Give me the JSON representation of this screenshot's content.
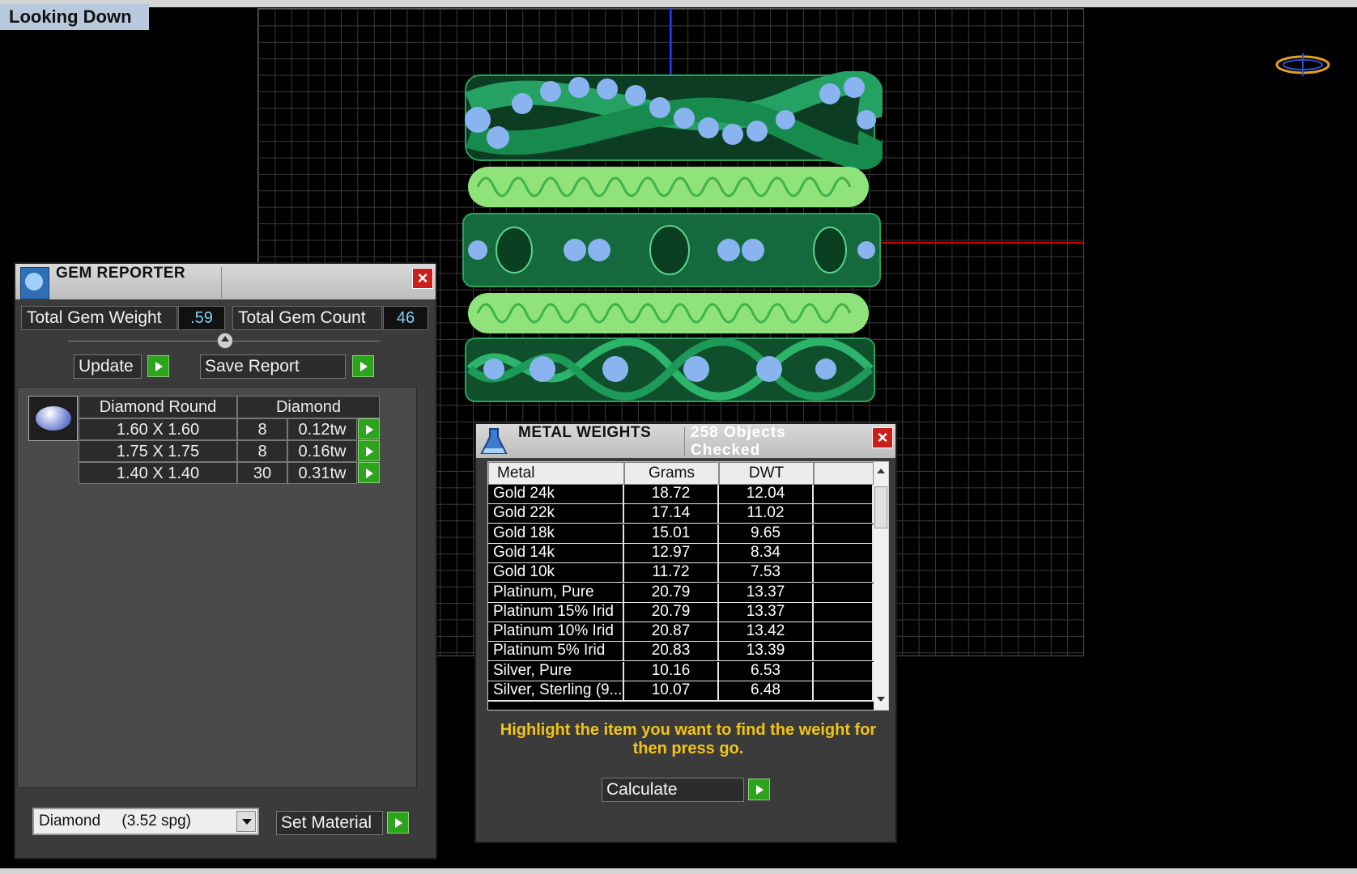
{
  "view": {
    "label": "Looking Down"
  },
  "gem_reporter": {
    "title": "GEM REPORTER",
    "total_weight_label": "Total Gem Weight",
    "total_weight_value": ".59",
    "total_count_label": "Total Gem Count",
    "total_count_value": "46",
    "update_label": "Update",
    "save_report_label": "Save Report",
    "gem_header": {
      "shape": "Diamond Round",
      "material": "Diamond"
    },
    "gems": [
      {
        "size": "1.60 X 1.60",
        "count": "8",
        "weight": "0.12tw"
      },
      {
        "size": "1.75 X 1.75",
        "count": "8",
        "weight": "0.16tw"
      },
      {
        "size": "1.40 X 1.40",
        "count": "30",
        "weight": "0.31tw"
      }
    ],
    "material_select": "Diamond     (3.52 spg)",
    "set_material_label": "Set Material"
  },
  "metal_weights": {
    "title": "METAL WEIGHTS",
    "objects_checked": "258 Objects Checked",
    "columns": [
      "Metal",
      "Grams",
      "DWT"
    ],
    "rows": [
      {
        "metal": "Gold 24k",
        "grams": "18.72",
        "dwt": "12.04"
      },
      {
        "metal": "Gold 22k",
        "grams": "17.14",
        "dwt": "11.02"
      },
      {
        "metal": "Gold 18k",
        "grams": "15.01",
        "dwt": "9.65"
      },
      {
        "metal": "Gold 14k",
        "grams": "12.97",
        "dwt": "8.34"
      },
      {
        "metal": "Gold 10k",
        "grams": "11.72",
        "dwt": "7.53"
      },
      {
        "metal": "Platinum, Pure",
        "grams": "20.79",
        "dwt": "13.37"
      },
      {
        "metal": "Platinum 15% Irid",
        "grams": "20.79",
        "dwt": "13.37"
      },
      {
        "metal": "Platinum 10% Irid",
        "grams": "20.87",
        "dwt": "13.42"
      },
      {
        "metal": "Platinum 5% Irid",
        "grams": "20.83",
        "dwt": "13.39"
      },
      {
        "metal": "Silver, Pure",
        "grams": "10.16",
        "dwt": "6.53"
      },
      {
        "metal": "Silver, Sterling (9...",
        "grams": "10.07",
        "dwt": "6.48"
      }
    ],
    "instruction": "Highlight the item you want to find the weight for then press go.",
    "calculate_label": "Calculate"
  },
  "colors": {
    "accent_green": "#2ea31d",
    "close_red": "#c9201d",
    "value_blue": "#7dd3f0",
    "instruction_yellow": "#f0c419",
    "ring_green": "#1e8a4e",
    "ring_lightgreen": "#8fe37a",
    "gem_blue": "#8ab4f0"
  }
}
